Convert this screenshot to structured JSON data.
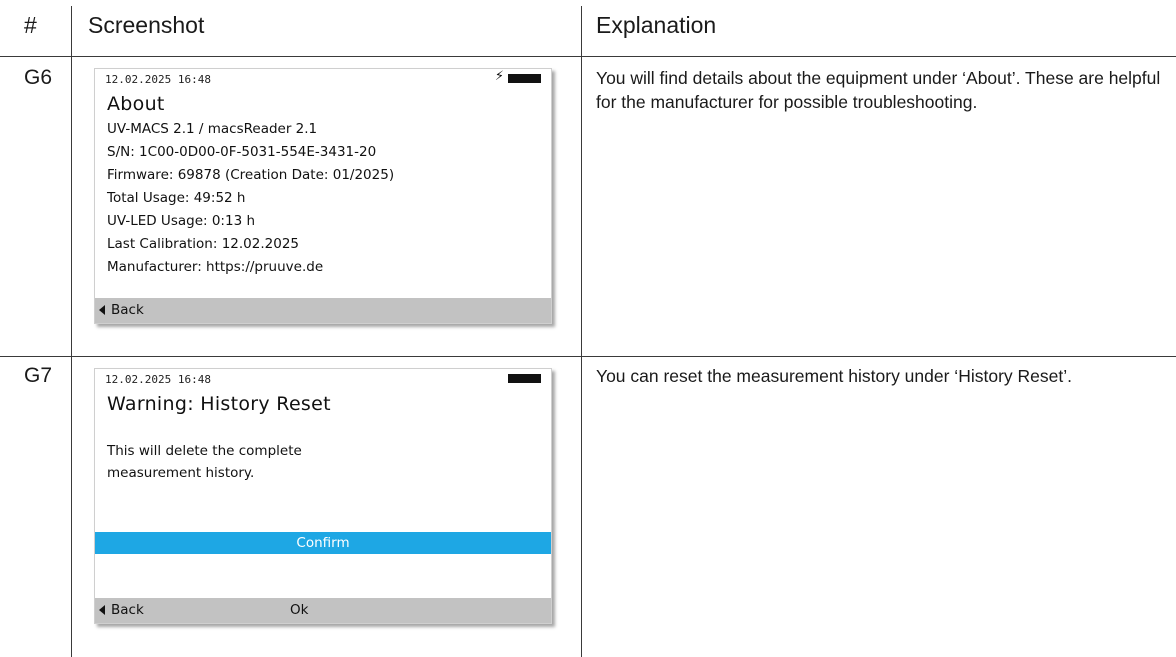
{
  "header": {
    "col_id": "#",
    "col_screenshot": "Screenshot",
    "col_explanation": "Explanation"
  },
  "rows": [
    {
      "id": "G6",
      "explanation": "You will find details about the equipment under ‘About’. These are helpful for the manufacturer for possible troubleshooting.",
      "screen": {
        "datetime": "12.02.2025 16:48",
        "charging_icon": "lightning-bolt",
        "battery_icon": "battery-full",
        "title": "About",
        "lines": [
          "UV-MACS 2.1 / macsReader 2.1",
          "S/N: 1C00-0D00-0F-5031-554E-3431-20",
          "Firmware: 69878 (Creation Date: 01/2025)",
          "Total Usage: 49:52 h",
          "UV-LED Usage: 0:13 h",
          "Last Calibration: 12.02.2025",
          "Manufacturer: https://pruuve.de"
        ],
        "back_label": "Back"
      }
    },
    {
      "id": "G7",
      "explanation": "You can reset the measurement history under ‘History Reset’.",
      "screen": {
        "datetime": "12.02.2025 16:48",
        "battery_icon": "battery-full",
        "title": "Warning: History Reset",
        "message_lines": [
          "This will delete the complete",
          "measurement history."
        ],
        "confirm_label": "Confirm",
        "confirm_color": "#1ea7e4",
        "back_label": "Back",
        "ok_label": "Ok"
      }
    }
  ]
}
